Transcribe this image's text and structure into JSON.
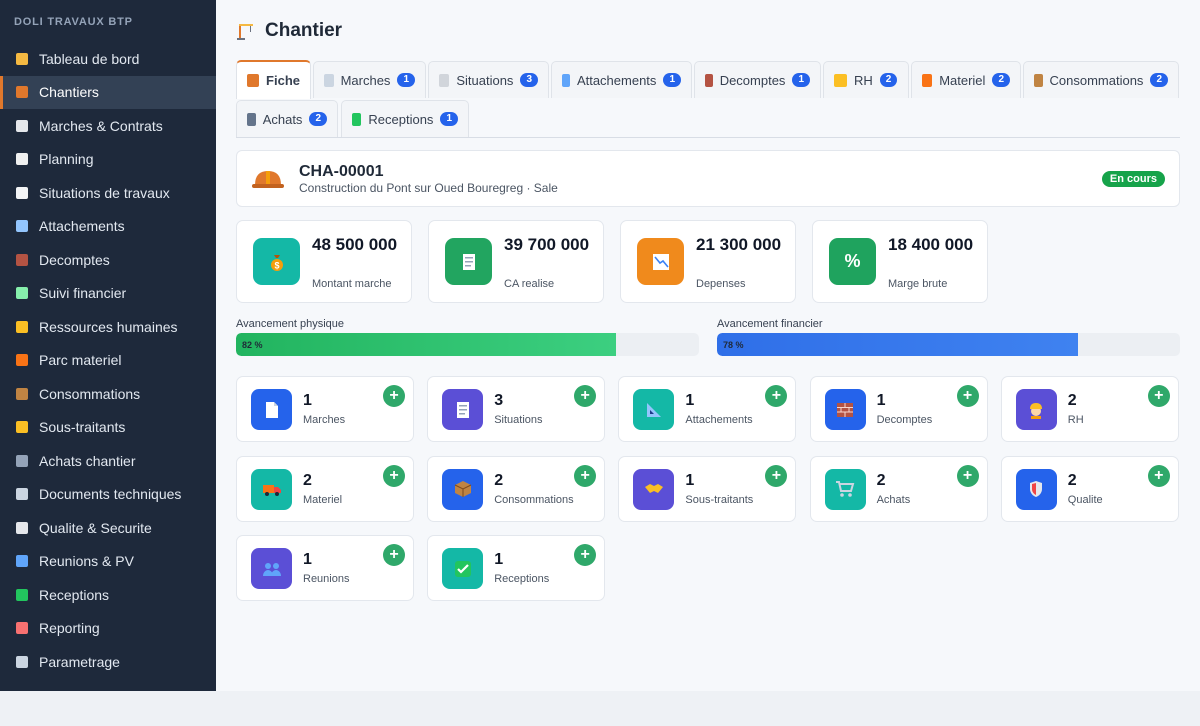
{
  "sidebar": {
    "brand": "DOLI TRAVAUX BTP",
    "items": [
      {
        "label": "Tableau de bord",
        "icon": "bar-chart-icon",
        "color": "#f5b942"
      },
      {
        "label": "Chantiers",
        "icon": "crane-icon",
        "color": "#e0782c"
      },
      {
        "label": "Marches & Contrats",
        "icon": "document-icon",
        "color": "#e5e7eb"
      },
      {
        "label": "Planning",
        "icon": "calendar-icon",
        "color": "#f0f0f0"
      },
      {
        "label": "Situations de travaux",
        "icon": "receipt-icon",
        "color": "#f3f4f6"
      },
      {
        "label": "Attachements",
        "icon": "ruler-triangle-icon",
        "color": "#93c5fd"
      },
      {
        "label": "Decomptes",
        "icon": "brick-icon",
        "color": "#b45343"
      },
      {
        "label": "Suivi financier",
        "icon": "money-icon",
        "color": "#86efac"
      },
      {
        "label": "Ressources humaines",
        "icon": "worker-icon",
        "color": "#fbbf24"
      },
      {
        "label": "Parc materiel",
        "icon": "truck-icon",
        "color": "#f97316"
      },
      {
        "label": "Consommations",
        "icon": "package-icon",
        "color": "#c08443"
      },
      {
        "label": "Sous-traitants",
        "icon": "handshake-icon",
        "color": "#fbbf24"
      },
      {
        "label": "Achats chantier",
        "icon": "cart-icon",
        "color": "#94a3b8"
      },
      {
        "label": "Documents techniques",
        "icon": "folder-icon",
        "color": "#cbd5e1"
      },
      {
        "label": "Qualite & Securite",
        "icon": "shield-icon",
        "color": "#e5e7eb"
      },
      {
        "label": "Reunions & PV",
        "icon": "people-icon",
        "color": "#60a5fa"
      },
      {
        "label": "Receptions",
        "icon": "check-icon",
        "color": "#22c55e"
      },
      {
        "label": "Reporting",
        "icon": "line-chart-icon",
        "color": "#f87171"
      },
      {
        "label": "Parametrage",
        "icon": "gear-icon",
        "color": "#cbd5e1"
      }
    ],
    "active_index": 1
  },
  "page": {
    "title": "Chantier",
    "title_icon": "crane-icon"
  },
  "tabs": [
    {
      "label": "Fiche",
      "badge": "",
      "icon": "crane-icon",
      "color": "#e0782c",
      "active": true
    },
    {
      "label": "Marches",
      "badge": "1",
      "icon": "document-icon",
      "color": "#cbd5e1"
    },
    {
      "label": "Situations",
      "badge": "3",
      "icon": "receipt-icon",
      "color": "#d1d5db"
    },
    {
      "label": "Attachements",
      "badge": "1",
      "icon": "ruler-triangle-icon",
      "color": "#60a5fa"
    },
    {
      "label": "Decomptes",
      "badge": "1",
      "icon": "brick-icon",
      "color": "#b45343"
    },
    {
      "label": "RH",
      "badge": "2",
      "icon": "worker-icon",
      "color": "#fbbf24"
    },
    {
      "label": "Materiel",
      "badge": "2",
      "icon": "truck-icon",
      "color": "#f97316"
    },
    {
      "label": "Consommations",
      "badge": "2",
      "icon": "package-icon",
      "color": "#c08443"
    },
    {
      "label": "Achats",
      "badge": "2",
      "icon": "cart-icon",
      "color": "#64748b"
    },
    {
      "label": "Receptions",
      "badge": "1",
      "icon": "check-icon",
      "color": "#22c55e"
    }
  ],
  "chantier": {
    "ref": "CHA-00001",
    "subtitle": "Construction du Pont sur Oued Bouregreg · Sale",
    "status": "En cours",
    "status_color": "#16a34a"
  },
  "kpis": [
    {
      "value": "48 500 000",
      "label": "Montant marche",
      "icon": "money-bag-icon",
      "color": "#14b8a6"
    },
    {
      "value": "39 700 000",
      "label": "CA realise",
      "icon": "receipt-icon",
      "color": "#22a560"
    },
    {
      "value": "21 300 000",
      "label": "Depenses",
      "icon": "trend-down-icon",
      "color": "#f08a1c"
    },
    {
      "value": "18 400 000",
      "label": "Marge brute",
      "icon": "percent-icon",
      "glyph": "%",
      "color": "#1fa35e"
    }
  ],
  "progress": {
    "physique": {
      "label": "Avancement physique",
      "value": 82,
      "text": "82 %",
      "color": "#22b45f"
    },
    "financier": {
      "label": "Avancement financier",
      "value": 78,
      "text": "78 %",
      "color": "#2f6fe8"
    }
  },
  "modules": [
    {
      "count": "1",
      "label": "Marches",
      "icon": "document-icon",
      "color": "#2563eb"
    },
    {
      "count": "3",
      "label": "Situations",
      "icon": "receipt-icon",
      "color": "#5b4fd6"
    },
    {
      "count": "1",
      "label": "Attachements",
      "icon": "ruler-triangle-icon",
      "color": "#14b8a6"
    },
    {
      "count": "1",
      "label": "Decomptes",
      "icon": "brick-icon",
      "color": "#2563eb"
    },
    {
      "count": "2",
      "label": "RH",
      "icon": "worker-icon",
      "color": "#5b4fd6"
    },
    {
      "count": "2",
      "label": "Materiel",
      "icon": "truck-icon",
      "color": "#14b8a6"
    },
    {
      "count": "2",
      "label": "Consommations",
      "icon": "package-icon",
      "color": "#2563eb"
    },
    {
      "count": "1",
      "label": "Sous-traitants",
      "icon": "handshake-icon",
      "color": "#5b4fd6"
    },
    {
      "count": "2",
      "label": "Achats",
      "icon": "cart-icon",
      "color": "#14b8a6"
    },
    {
      "count": "2",
      "label": "Qualite",
      "icon": "shield-icon",
      "color": "#2563eb"
    },
    {
      "count": "1",
      "label": "Reunions",
      "icon": "people-icon",
      "color": "#5b4fd6"
    },
    {
      "count": "1",
      "label": "Receptions",
      "icon": "check-icon",
      "color": "#14b8a6"
    }
  ],
  "add_label": "+"
}
